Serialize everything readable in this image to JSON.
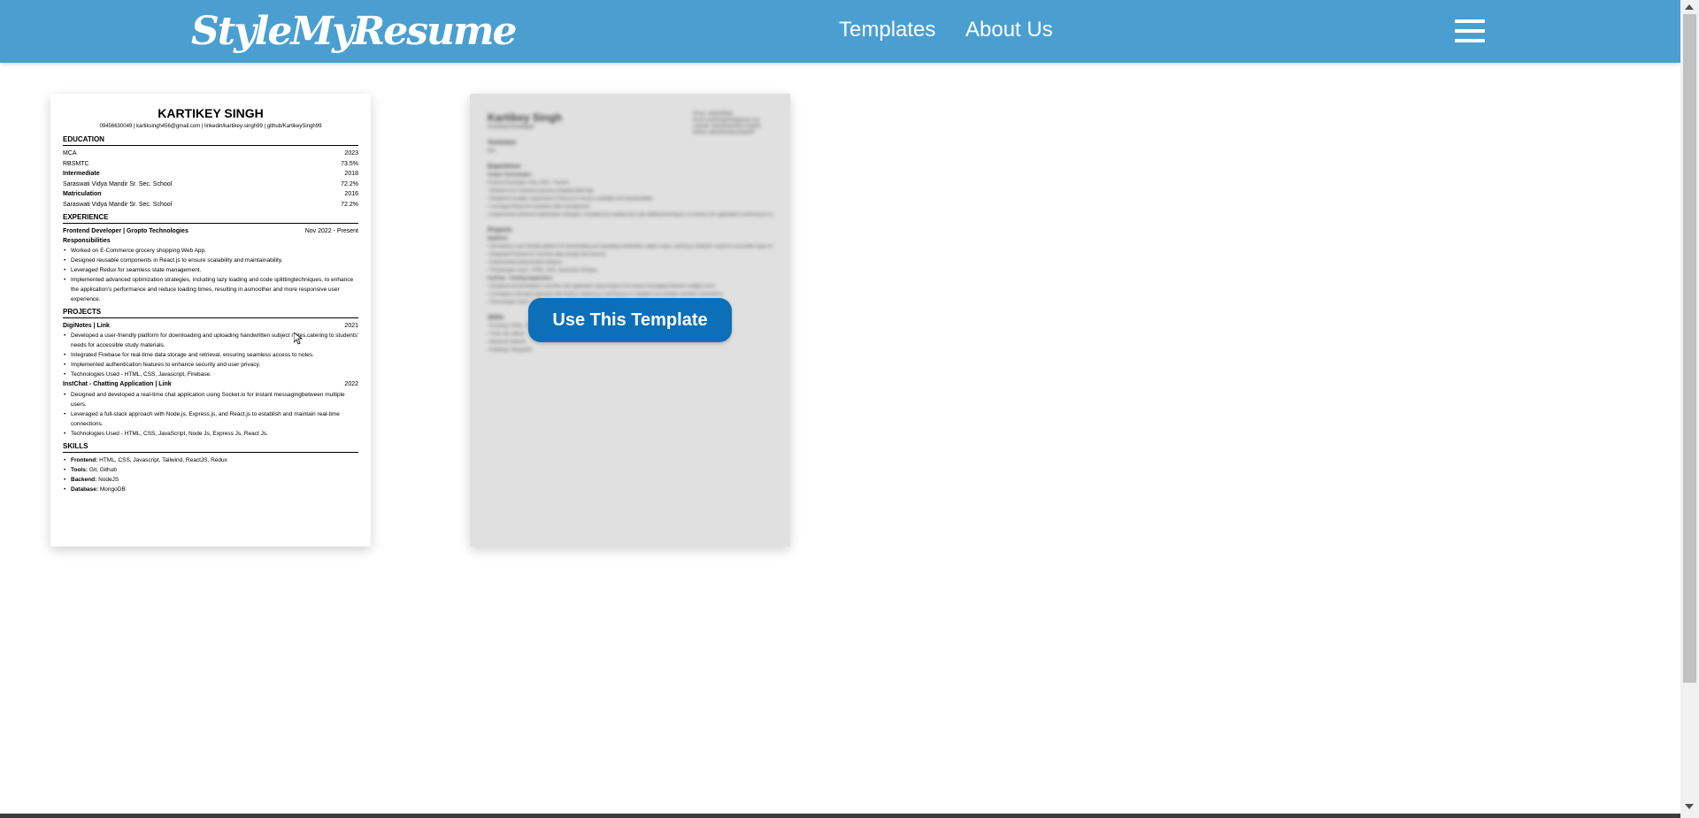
{
  "nav": {
    "logo": "StyleMyResume",
    "links": [
      "Templates",
      "About Us"
    ],
    "menu_icon": "hamburger-menu-icon"
  },
  "template1": {
    "name": "KARTIKEY SINGH",
    "contact": "09456630049 | kartiksingh456@gmail.com | linkedin/kartikey-singh99 | github/KartikeySingh99",
    "education_title": "EDUCATION",
    "education": [
      {
        "label": "MCA",
        "value": "2023",
        "bold": false
      },
      {
        "label": "RBSMTC",
        "value": "73.5%",
        "bold": false
      },
      {
        "label": "Intermediate",
        "value": "2018",
        "bold": true
      },
      {
        "label": "Saraswati Vidya Mandir Sr. Sec. School",
        "value": "72.2%",
        "bold": false
      },
      {
        "label": "Matriculation",
        "value": "2016",
        "bold": true
      },
      {
        "label": "Saraswati Vidya Mandir Sr. Sec. School",
        "value": "72.2%",
        "bold": false
      }
    ],
    "experience_title": "EXPERIENCE",
    "job_title": "Frontend Developer | Gropto Technologies",
    "job_dates": "Nov 2022 - Present",
    "responsibilities": "Responsibilities",
    "job_bullets": [
      "Worked on E-Commerce grocery shopping Web App.",
      "Designed reusable components in React.js to ensure scalability and maintainability.",
      "Leveraged Redux for seamless state management.",
      "Implemented advanced optimization strategies, including lazy loading and code splittingtechniques, to enhance the application's performance and reduce loading times, resulting in asmoother and more responsive user experience."
    ],
    "projects_title": "PROJECTS",
    "project1_title": "DigiNotes | Link",
    "project1_year": "2021",
    "project1_bullets": [
      "Developed a user-friendly platform for downloading and uploading handwritten subject notes,catering to students' needs for accessible study materials.",
      "Integrated Firebase for real-time data storage and retrieval, ensuring seamless access to notes.",
      "Implemented authentication features to enhance security and user privacy.",
      "Technologies Used - HTML, CSS, Javascript, Firebase."
    ],
    "project2_title": "InstChat - Chatting Application | Link",
    "project2_year": "2022",
    "project2_bullets": [
      "Designed and developed a real-time chat application using Socket.io for instant messagingbetween multiple users.",
      "Leveraged a full-stack approach with Node.js, Express.js, and React.js to establish and maintain real-time connections.",
      "Technologies Used - HTML, CSS, JavaScript, Node Js, Express Js, React Js."
    ],
    "skills_title": "SKILLS",
    "skills": [
      {
        "label": "Frontend:",
        "value": " HTML, CSS, Javascript, Tailwind, ReactJS, Redux"
      },
      {
        "label": "Tools:",
        "value": " Git, Github"
      },
      {
        "label": "Backend:",
        "value": " NodeJS"
      },
      {
        "label": "Database:",
        "value": " MongoDB"
      }
    ]
  },
  "template2": {
    "name": "Kartikey Singh",
    "role": "Frontend Developer",
    "contact": [
      "Phone: 9456630049",
      "Email: kartiksingh456@gmail.com",
      "LinkedIn: linkedin/kartikey-singh99",
      "GitHub: github/KartikeySingh99"
    ],
    "summary_title": "Summary",
    "summary_text": "N/A",
    "experience_title": "Experience",
    "company": "Gropto Technologies",
    "job_line": "Frontend Developer | Nov 2022 - Present",
    "job_bullets": [
      "Worked on E-Commerce grocery shopping Web App.",
      "Designed reusable components in React.js to ensure scalability and maintainability.",
      "Leveraged Redux for seamless state management.",
      "Implemented advanced optimization strategies, including lazy loading and code splitting techniques, to enhance the application's performance and reduce loading times, resulting in a smoother and more responsive user experience."
    ],
    "projects_title": "Projects",
    "project1": "DigiNotes",
    "project1_bullets": [
      "Developed a user-friendly platform for downloading and uploading handwritten subject notes, catering to students' needs for accessible study materials.",
      "Integrated Firebase for real-time data storage and retrieval.",
      "Implemented authentication features.",
      "Technologies Used - HTML, CSS, Javascript, Firebase."
    ],
    "project2": "InstChat - Chatting Application",
    "project2_bullets": [
      "Designed and developed a real-time chat application using Socket.io for instant messaging between multiple users.",
      "Leveraged a full-stack approach with Node.js, Express.js, and React.js to establish and maintain real-time connections.",
      "Technologies Used - HTML, CSS, JavaScript, Node Js, Express Js, React Js."
    ],
    "skills_title": "Skills",
    "skills": [
      "Frontend: HTML, CSS, Javascript, Tailwind, ReactJS, Redux",
      "Tools: Git, Github",
      "Backend: NodeJS",
      "Database: MongoDB"
    ],
    "cta": "Use This Template"
  }
}
